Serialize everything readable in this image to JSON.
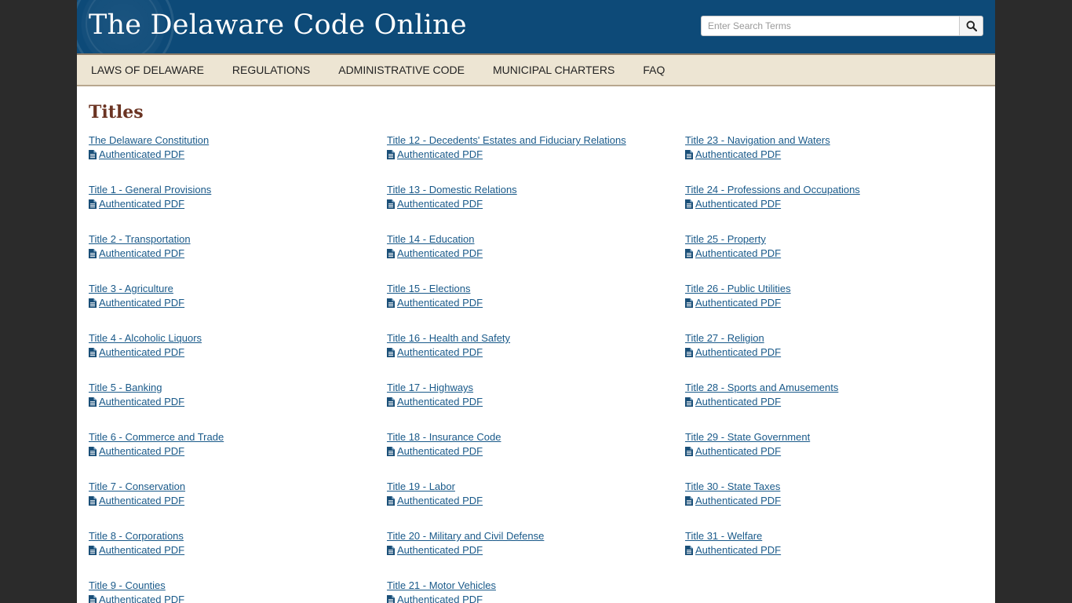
{
  "header": {
    "site_title": "The Delaware Code Online",
    "search_placeholder": "Enter Search Terms",
    "search_button_icon": "search-icon"
  },
  "nav": {
    "items": [
      {
        "label": "LAWS OF DELAWARE"
      },
      {
        "label": "REGULATIONS"
      },
      {
        "label": "ADMINISTRATIVE CODE"
      },
      {
        "label": "MUNICIPAL CHARTERS"
      },
      {
        "label": "FAQ"
      }
    ]
  },
  "main": {
    "heading": "Titles",
    "pdf_label": "Authenticated PDF",
    "pdf_icon": "file-icon",
    "columns": [
      [
        "The Delaware Constitution",
        "Title 1 - General Provisions",
        "Title 2 - Transportation",
        "Title 3 - Agriculture",
        "Title 4 - Alcoholic Liquors",
        "Title 5 - Banking",
        "Title 6 - Commerce and Trade",
        "Title 7 - Conservation",
        "Title 8 - Corporations",
        "Title 9 - Counties"
      ],
      [
        "Title 12 - Decedents' Estates and Fiduciary Relations",
        "Title 13 - Domestic Relations",
        "Title 14 - Education",
        "Title 15 - Elections",
        "Title 16 - Health and Safety",
        "Title 17 - Highways",
        "Title 18 - Insurance Code",
        "Title 19 - Labor",
        "Title 20 - Military and Civil Defense",
        "Title 21 - Motor Vehicles"
      ],
      [
        "Title 23 - Navigation and Waters",
        "Title 24 - Professions and Occupations",
        "Title 25 - Property",
        "Title 26 - Public Utilities",
        "Title 27 - Religion",
        "Title 28 - Sports and Amusements",
        "Title 29 - State Government",
        "Title 30 - State Taxes",
        "Title 31 - Welfare"
      ]
    ]
  },
  "colors": {
    "header_bg": "#0d4a78",
    "nav_bg": "#ede5d3",
    "link": "#1a5a8a",
    "heading": "#6b3423"
  }
}
